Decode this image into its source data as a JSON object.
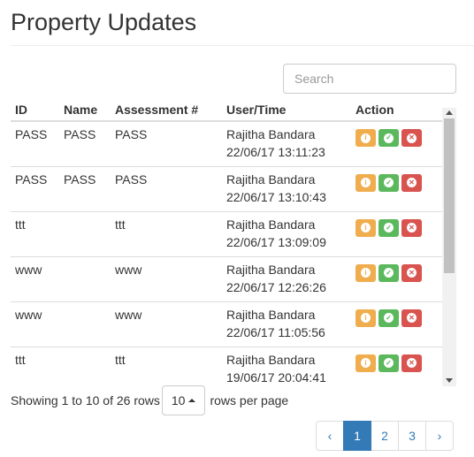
{
  "page": {
    "title": "Property Updates"
  },
  "search": {
    "placeholder": "Search"
  },
  "table": {
    "headers": {
      "id": "ID",
      "name": "Name",
      "assessment": "Assessment #",
      "user_time": "User/Time",
      "action": "Action"
    },
    "rows": [
      {
        "id": "PASS",
        "name": "PASS",
        "assessment": "PASS",
        "user": "Rajitha Bandara",
        "time": "22/06/17 13:11:23"
      },
      {
        "id": "PASS",
        "name": "PASS",
        "assessment": "PASS",
        "user": "Rajitha Bandara",
        "time": "22/06/17 13:10:43"
      },
      {
        "id": "ttt",
        "name": "",
        "assessment": "ttt",
        "user": "Rajitha Bandara",
        "time": "22/06/17 13:09:09"
      },
      {
        "id": "www",
        "name": "",
        "assessment": "www",
        "user": "Rajitha Bandara",
        "time": "22/06/17 12:26:26"
      },
      {
        "id": "www",
        "name": "",
        "assessment": "www",
        "user": "Rajitha Bandara",
        "time": "22/06/17 11:05:56"
      },
      {
        "id": "ttt",
        "name": "",
        "assessment": "ttt",
        "user": "Rajitha Bandara",
        "time": "19/06/17 20:04:41"
      }
    ],
    "action_icons": {
      "info": "info-circle-icon",
      "approve": "check-circle-icon",
      "reject": "times-circle-icon"
    }
  },
  "pager": {
    "showing_text": "Showing 1 to 10 of 26 rows",
    "page_size": "10",
    "rows_per_page_text": "rows per page",
    "prev": "‹",
    "next": "›",
    "pages": [
      "1",
      "2",
      "3"
    ],
    "active_page": "1"
  },
  "colors": {
    "info": "#f0ad4e",
    "approve": "#5cb85c",
    "reject": "#d9534f",
    "primary": "#337ab7"
  }
}
